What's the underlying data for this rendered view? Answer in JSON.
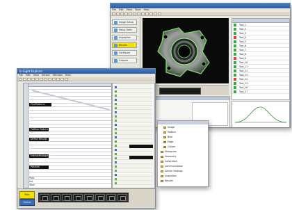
{
  "right_window": {
    "title": "",
    "menu": [
      "File",
      "Edit",
      "View",
      "Tools",
      "Help"
    ],
    "left_panel_buttons": [
      {
        "label": "Image Setup",
        "active": false
      },
      {
        "label": "Setup Tools",
        "active": false
      },
      {
        "label": "Inspection",
        "active": false
      },
      {
        "label": "Results",
        "active": true
      },
      {
        "label": "Configure",
        "active": false
      },
      {
        "label": "Outputs",
        "active": false
      }
    ],
    "status_tag": "Run",
    "tools_list": [
      "Tool_1",
      "Tool_2",
      "Tool_3",
      "Tool_4",
      "Tool_5",
      "Tool_6",
      "Tool_7",
      "Tool_8",
      "Tool_9",
      "Tool_10",
      "Tool_11",
      "Tool_12",
      "Tool_13",
      "Tool_14",
      "Tool_15",
      "Tool_16",
      "Tool_17"
    ],
    "tree_items": [
      "Image",
      "Pattern",
      "Blob",
      "Edge",
      "Caliper",
      "Histogram",
      "Geometry",
      "Calibration",
      "Communication",
      "Sensor Settings",
      "Inspection",
      "Results"
    ]
  },
  "left_window": {
    "title": "In-Sight Explorer",
    "menu": [
      "File",
      "Edit",
      "View",
      "Sensor",
      "Window",
      "Help"
    ],
    "sections": [
      "FindPatterns",
      "PatMax Pattern",
      "Defect Results",
      "ExtractHistogram",
      "Position"
    ],
    "results_labels": [
      "Pass",
      "Fail",
      "Total"
    ],
    "run_button": "Run",
    "online_button": "Online"
  }
}
